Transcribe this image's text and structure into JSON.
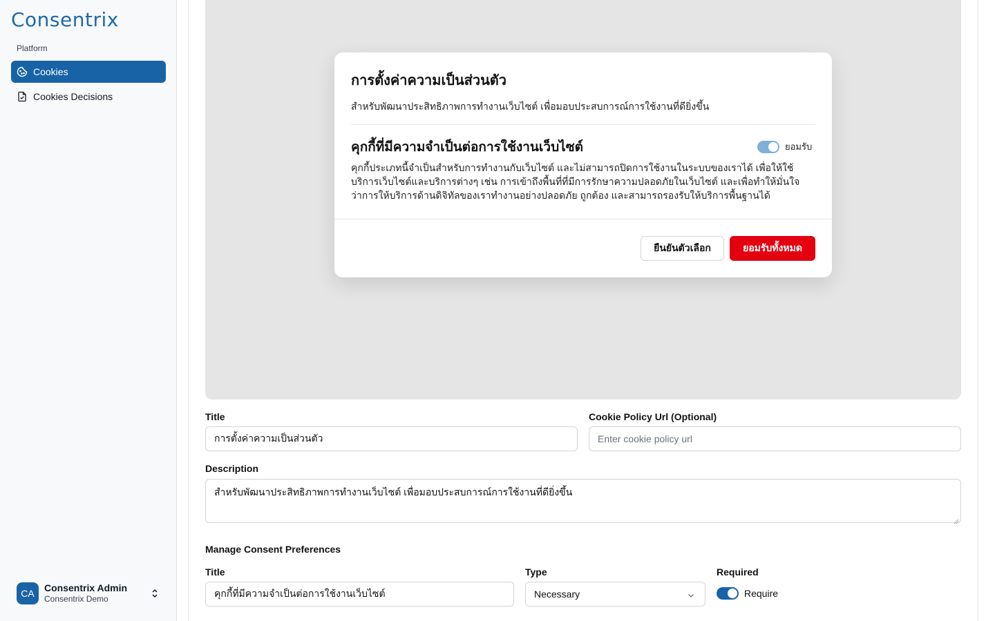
{
  "sidebar": {
    "logo_text": "Consentrix",
    "group_label": "Platform",
    "items": [
      {
        "label": "Cookies",
        "icon": "cookie-icon",
        "active": true
      },
      {
        "label": "Cookies Decisions",
        "icon": "file-check-icon",
        "active": false
      }
    ],
    "user": {
      "initials": "CA",
      "name": "Consentrix Admin",
      "org": "Consentrix Demo"
    }
  },
  "preview": {
    "title": "การตั้งค่าความเป็นส่วนตัว",
    "description": "สำหรับพัฒนาประสิทธิภาพการทำงานเว็บไซต์ เพื่อมอบประสบการณ์การใช้งานที่ดียิ่งขึ้น",
    "section_title": "คุกกี้ที่มีความจำเป็นต่อการใช้งานเว็บไซต์",
    "toggle_label": "ยอมรับ",
    "section_description": "คุกกี้ประเภทนี้จำเป็นสำหรับการทำงานกับเว็บไซต์ และไม่สามารถปิดการใช้งานในระบบของเราได้ เพื่อให้ใช้บริการเว็บไซต์และบริการต่างๆ เช่น การเข้าถึงพื้นที่ที่มีการรักษาความปลอดภัยในเว็บไซต์ และเพื่อทำให้มั่นใจว่าการให้บริการด้านดิจิทัลของเราทำงานอย่างปลอดภัย ถูกต้อง และสามารถรองรับให้บริการพื้นฐานได้",
    "confirm_button": "ยืนยันตัวเลือก",
    "accept_all_button": "ยอมรับทั้งหมด"
  },
  "form": {
    "title_label": "Title",
    "title_value": "การตั้งค่าความเป็นส่วนตัว",
    "policy_label": "Cookie Policy Url (Optional)",
    "policy_placeholder": "Enter cookie policy url",
    "description_label": "Description",
    "description_value": "สำหรับพัฒนาประสิทธิภาพการทำงานเว็บไซต์ เพื่อมอบประสบการณ์การใช้งานที่ดียิ่งขึ้น",
    "manage_heading": "Manage Consent Preferences",
    "pref_title_label": "Title",
    "pref_title_value": "คุกกี้ที่มีความจำเป็นต่อการใช้งานเว็บไซต์",
    "type_label": "Type",
    "type_value": "Necessary",
    "required_label": "Required",
    "required_toggle_label": "Require"
  },
  "colors": {
    "brand": "#1763a6",
    "accept_red": "#e3000f",
    "preview_bg": "#e5e5e5"
  }
}
